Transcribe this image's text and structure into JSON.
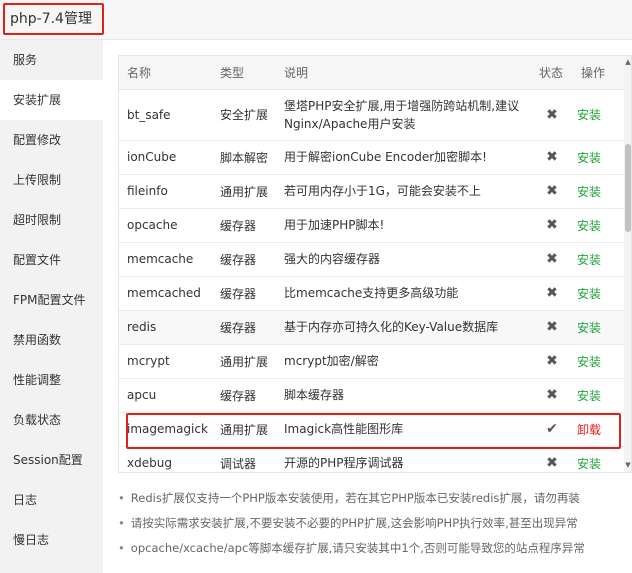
{
  "title": "php-7.4管理",
  "sidebar": {
    "active_index": 1,
    "items": [
      "服务",
      "安装扩展",
      "配置修改",
      "上传限制",
      "超时限制",
      "配置文件",
      "FPM配置文件",
      "禁用函数",
      "性能调整",
      "负载状态",
      "Session配置",
      "日志",
      "慢日志"
    ]
  },
  "table": {
    "columns": {
      "name": "名称",
      "type": "类型",
      "desc": "说明",
      "status": "状态",
      "action": "操作"
    },
    "rows": [
      {
        "name": "bt_safe",
        "type": "安全扩展",
        "desc": "堡塔PHP安全扩展,用于增强防跨站机制,建议Nginx/Apache用户安装",
        "status": "✖",
        "action": "安装",
        "installed": false
      },
      {
        "name": "ionCube",
        "type": "脚本解密",
        "desc": "用于解密ionCube Encoder加密脚本!",
        "status": "✖",
        "action": "安装",
        "installed": false
      },
      {
        "name": "fileinfo",
        "type": "通用扩展",
        "desc": "若可用内存小于1G，可能会安装不上",
        "status": "✖",
        "action": "安装",
        "installed": false
      },
      {
        "name": "opcache",
        "type": "缓存器",
        "desc": "用于加速PHP脚本!",
        "status": "✖",
        "action": "安装",
        "installed": false
      },
      {
        "name": "memcache",
        "type": "缓存器",
        "desc": "强大的内容缓存器",
        "status": "✖",
        "action": "安装",
        "installed": false
      },
      {
        "name": "memcached",
        "type": "缓存器",
        "desc": "比memcache支持更多高级功能",
        "status": "✖",
        "action": "安装",
        "installed": false
      },
      {
        "name": "redis",
        "type": "缓存器",
        "desc": "基于内存亦可持久化的Key-Value数据库",
        "status": "✖",
        "action": "安装",
        "installed": false
      },
      {
        "name": "mcrypt",
        "type": "通用扩展",
        "desc": "mcrypt加密/解密",
        "status": "✖",
        "action": "安装",
        "installed": false
      },
      {
        "name": "apcu",
        "type": "缓存器",
        "desc": "脚本缓存器",
        "status": "✖",
        "action": "安装",
        "installed": false
      },
      {
        "name": "imagemagick",
        "type": "通用扩展",
        "desc": "Imagick高性能图形库",
        "status": "✔",
        "action": "卸载",
        "installed": true
      },
      {
        "name": "xdebug",
        "type": "调试器",
        "desc": "开源的PHP程序调试器",
        "status": "✖",
        "action": "安装",
        "installed": false
      }
    ]
  },
  "notes": [
    "Redis扩展仅支持一个PHP版本安装使用，若在其它PHP版本已安装redis扩展，请勿再装",
    "请按实际需求安装扩展,不要安装不必要的PHP扩展,这会影响PHP执行效率,甚至出现异常",
    "opcache/xcache/apc等脚本缓存扩展,请只安装其中1个,否则可能导致您的站点程序异常"
  ],
  "colors": {
    "install": "#20a53a",
    "uninstall": "#e0201a",
    "highlight_border": "#e0201a"
  }
}
